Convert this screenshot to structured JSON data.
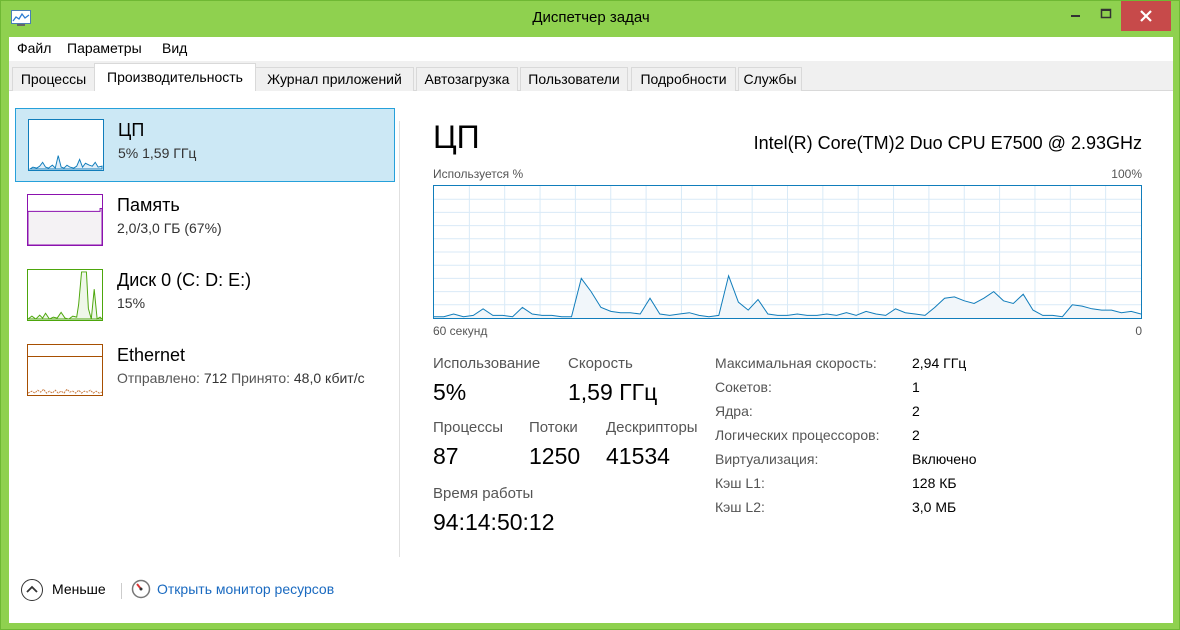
{
  "window": {
    "title": "Диспетчер задач"
  },
  "menu": [
    "Файл",
    "Параметры",
    "Вид"
  ],
  "tabs": [
    "Процессы",
    "Производительность",
    "Журнал приложений",
    "Автозагрузка",
    "Пользователи",
    "Подробности",
    "Службы"
  ],
  "active_tab": "Производительность",
  "sidebar": {
    "items": [
      {
        "name": "ЦП",
        "detail": "5% 1,59 ГГц",
        "color": "#117dbb",
        "selected": true
      },
      {
        "name": "Память",
        "detail": "2,0/3,0 ГБ (67%)",
        "color": "#8b12ae"
      },
      {
        "name": "Диск 0 (C: D: E:)",
        "detail": "15%",
        "color": "#4da60c"
      },
      {
        "name": "Ethernet",
        "sent_label": "Отправлено:",
        "sent_value": "712",
        "recv_label": "Принято:",
        "recv_value": "48,0 кбит/с",
        "color": "#a74f01"
      }
    ]
  },
  "main": {
    "title": "ЦП",
    "model": "Intel(R) Core(TM)2 Duo CPU E7500 @ 2.93GHz",
    "graph": {
      "top_left": "Используется %",
      "top_right": "100%",
      "bottom_left": "60 секунд",
      "bottom_right": "0"
    },
    "stats": {
      "usage": {
        "label": "Использование",
        "value": "5%"
      },
      "speed": {
        "label": "Скорость",
        "value": "1,59 ГГц"
      },
      "processes": {
        "label": "Процессы",
        "value": "87"
      },
      "threads": {
        "label": "Потоки",
        "value": "1250"
      },
      "handles": {
        "label": "Дескрипторы",
        "value": "41534"
      },
      "uptime": {
        "label": "Время работы",
        "value": "94:14:50:12"
      }
    },
    "info": [
      {
        "label": "Максимальная скорость:",
        "value": "2,94 ГГц"
      },
      {
        "label": "Сокетов:",
        "value": "1"
      },
      {
        "label": "Ядра:",
        "value": "2"
      },
      {
        "label": "Логических процессоров:",
        "value": "2"
      },
      {
        "label": "Виртуализация:",
        "value": "Включено"
      },
      {
        "label": "Кэш L1:",
        "value": "128 КБ"
      },
      {
        "label": "Кэш L2:",
        "value": "3,0 МБ"
      }
    ]
  },
  "footer": {
    "less": "Меньше",
    "resmon": "Открыть монитор ресурсов"
  },
  "chart_data": {
    "type": "line",
    "ylim": [
      0,
      100
    ],
    "x_label": "60 секунд",
    "values": [
      1,
      1,
      3,
      1,
      2,
      7,
      2,
      2,
      1,
      8,
      3,
      2,
      2,
      1,
      1,
      30,
      20,
      8,
      5,
      4,
      4,
      3,
      15,
      3,
      2,
      3,
      4,
      2,
      1,
      2,
      32,
      12,
      6,
      14,
      3,
      2,
      2,
      3,
      2,
      2,
      3,
      2,
      4,
      2,
      5,
      3,
      2,
      7,
      4,
      3,
      2,
      8,
      15,
      16,
      13,
      11,
      15,
      20,
      13,
      11,
      18,
      6,
      2,
      2,
      1,
      10,
      9,
      7,
      6,
      6,
      4,
      5,
      3
    ]
  }
}
